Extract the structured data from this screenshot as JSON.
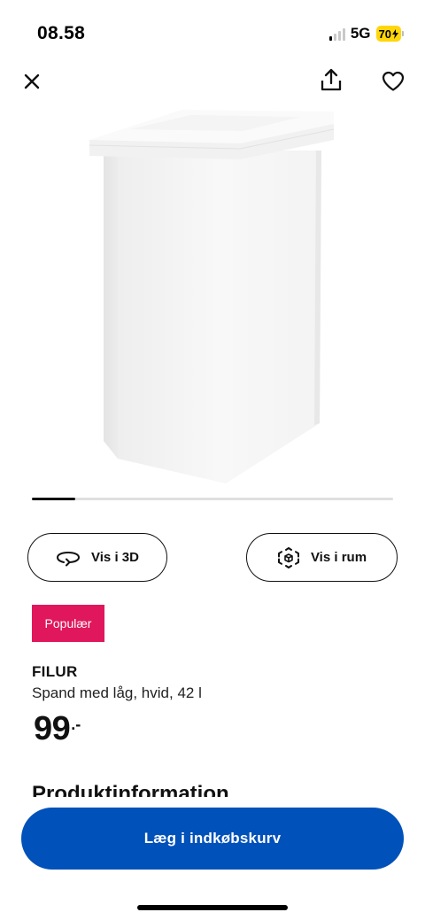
{
  "status_bar": {
    "time": "08.58",
    "network": "5G",
    "battery": "70",
    "signal_bars_active": 1,
    "signal_bars_total": 4
  },
  "icons": {
    "close": "close-icon",
    "share": "share-icon",
    "favorite": "heart-icon",
    "view_3d": "rotate-3d-icon",
    "view_room": "ar-cube-icon"
  },
  "gallery": {
    "current_image": 1,
    "progress_fraction": 0.12
  },
  "actions": {
    "view_3d_label": "Vis i 3D",
    "view_room_label": "Vis i rum"
  },
  "product": {
    "badge": "Populær",
    "name": "FILUR",
    "description": "Spand med låg, hvid, 42 l",
    "price": "99",
    "price_suffix": ".-"
  },
  "section": {
    "heading": "Produktinformation"
  },
  "cart": {
    "button_label": "Læg i indkøbskurv"
  },
  "colors": {
    "badge_bg": "#e0175c",
    "cart_button_bg": "#0051ba",
    "battery_bg": "#ffd60a"
  }
}
